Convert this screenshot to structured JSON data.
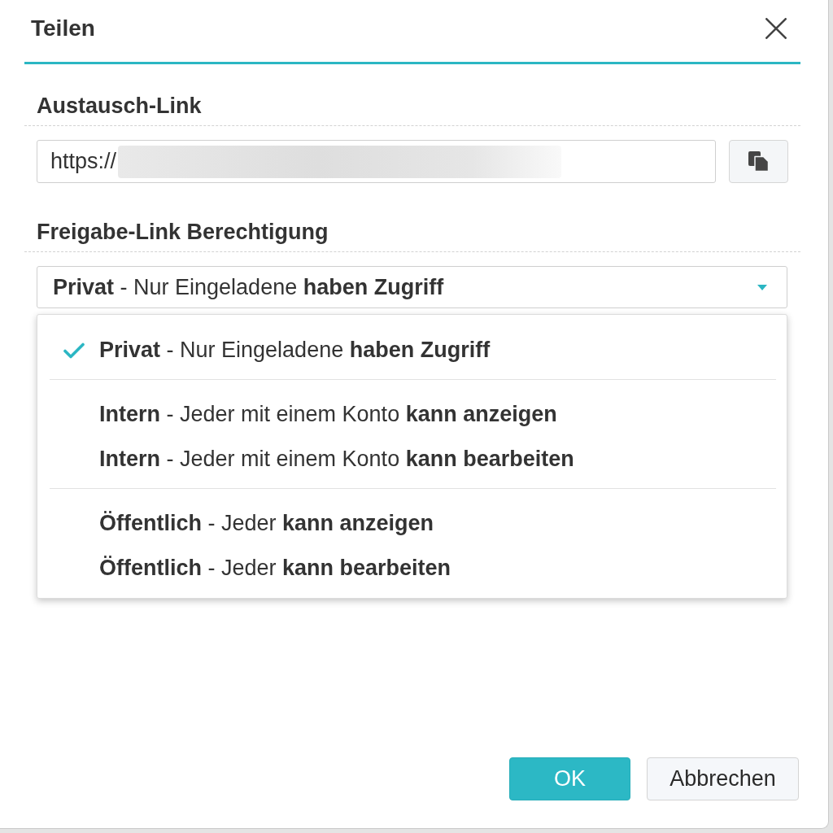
{
  "dialog": {
    "title": "Teilen"
  },
  "share_link": {
    "heading": "Austausch-Link",
    "value": "https://",
    "redacted": true
  },
  "permission": {
    "heading": "Freigabe-Link Berechtigung",
    "value": "**Privat** - Nur Eingeladene **haben Zugriff**",
    "expanded": true,
    "option_groups": [
      {
        "options": [
          {
            "label": "**Privat** - Nur Eingeladene **haben Zugriff**",
            "selected": true
          }
        ]
      },
      {
        "options": [
          {
            "label": "**Intern** - Jeder mit einem Konto **kann anzeigen**",
            "selected": false
          },
          {
            "label": "**Intern** - Jeder mit einem Konto **kann bearbeiten**",
            "selected": false
          }
        ]
      },
      {
        "options": [
          {
            "label": "**Öffentlich** - Jeder **kann anzeigen**",
            "selected": false
          },
          {
            "label": "**Öffentlich** - Jeder **kann bearbeiten**",
            "selected": false
          }
        ]
      }
    ]
  },
  "buttons": [
    {
      "label": "OK",
      "kind": "primary"
    },
    {
      "label": "Abbrechen",
      "kind": "secondary"
    }
  ]
}
